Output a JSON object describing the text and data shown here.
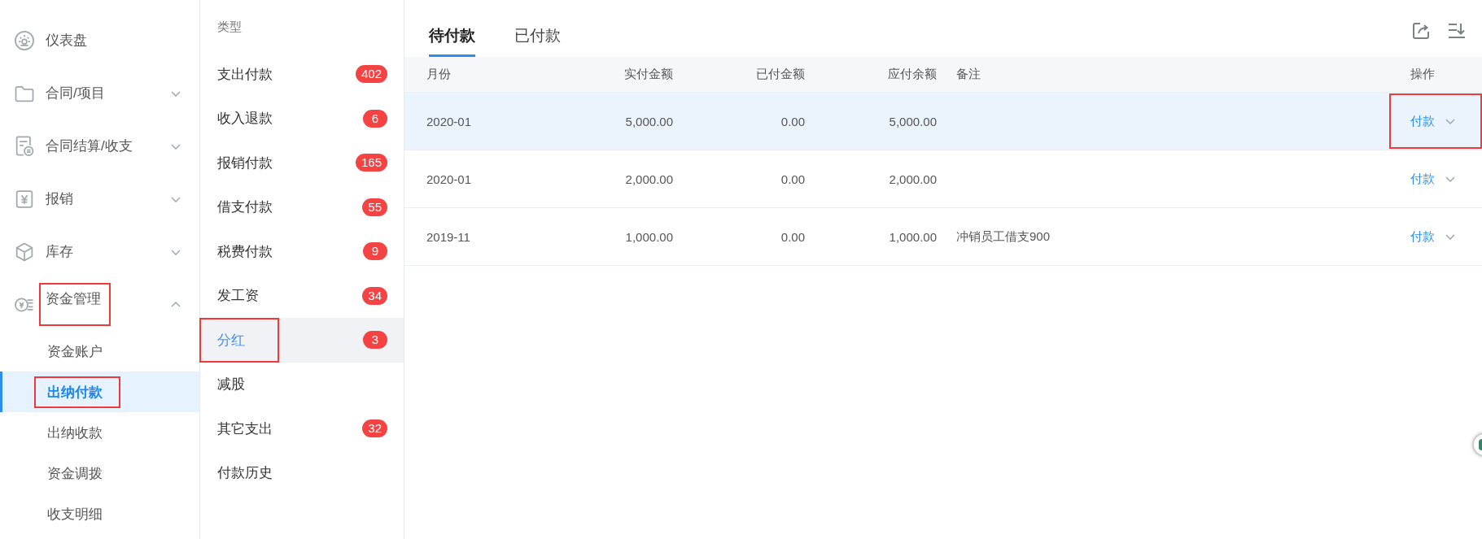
{
  "sidebar": {
    "items": [
      {
        "label": "仪表盘",
        "kind": "link",
        "annotated": false
      },
      {
        "label": "合同/项目",
        "kind": "group",
        "expanded": false,
        "annotated": false
      },
      {
        "label": "合同结算/收支",
        "kind": "group",
        "expanded": false,
        "annotated": false
      },
      {
        "label": "报销",
        "kind": "group",
        "expanded": false,
        "annotated": false
      },
      {
        "label": "库存",
        "kind": "group",
        "expanded": false,
        "annotated": false
      },
      {
        "label": "资金管理",
        "kind": "group",
        "expanded": true,
        "annotated": true,
        "children": [
          {
            "label": "资金账户",
            "selected": false,
            "annotated": false
          },
          {
            "label": "出纳付款",
            "selected": true,
            "annotated": true
          },
          {
            "label": "出纳收款",
            "selected": false,
            "annotated": false
          },
          {
            "label": "资金调拨",
            "selected": false,
            "annotated": false
          },
          {
            "label": "收支明细",
            "selected": false,
            "annotated": false
          }
        ]
      }
    ]
  },
  "types": {
    "title": "类型",
    "items": [
      {
        "label": "支出付款",
        "count": "402",
        "selected": false,
        "annotated": false
      },
      {
        "label": "收入退款",
        "count": "6",
        "selected": false,
        "annotated": false
      },
      {
        "label": "报销付款",
        "count": "165",
        "selected": false,
        "annotated": false
      },
      {
        "label": "借支付款",
        "count": "55",
        "selected": false,
        "annotated": false
      },
      {
        "label": "税费付款",
        "count": "9",
        "selected": false,
        "annotated": false
      },
      {
        "label": "发工资",
        "count": "34",
        "selected": false,
        "annotated": false
      },
      {
        "label": "分红",
        "count": "3",
        "selected": true,
        "annotated": true
      },
      {
        "label": "减股",
        "selected": false,
        "annotated": false
      },
      {
        "label": "其它支出",
        "count": "32",
        "selected": false,
        "annotated": false
      },
      {
        "label": "付款历史",
        "selected": false,
        "annotated": false
      }
    ]
  },
  "tabs": [
    {
      "label": "待付款",
      "selected": true
    },
    {
      "label": "已付款",
      "selected": false
    }
  ],
  "table": {
    "columns": [
      "月份",
      "实付金额",
      "已付金额",
      "应付余额",
      "备注",
      "操作"
    ],
    "rows": [
      {
        "cells": [
          "2020-01",
          "5,000.00",
          "0.00",
          "5,000.00",
          ""
        ],
        "action": "付款",
        "selected": true,
        "annotated": true
      },
      {
        "cells": [
          "2020-01",
          "2,000.00",
          "0.00",
          "2,000.00",
          ""
        ],
        "action": "付款",
        "selected": false,
        "annotated": false
      },
      {
        "cells": [
          "2019-11",
          "1,000.00",
          "0.00",
          "1,000.00",
          "冲销员工借支900"
        ],
        "action": "付款",
        "selected": false,
        "annotated": false
      }
    ]
  }
}
